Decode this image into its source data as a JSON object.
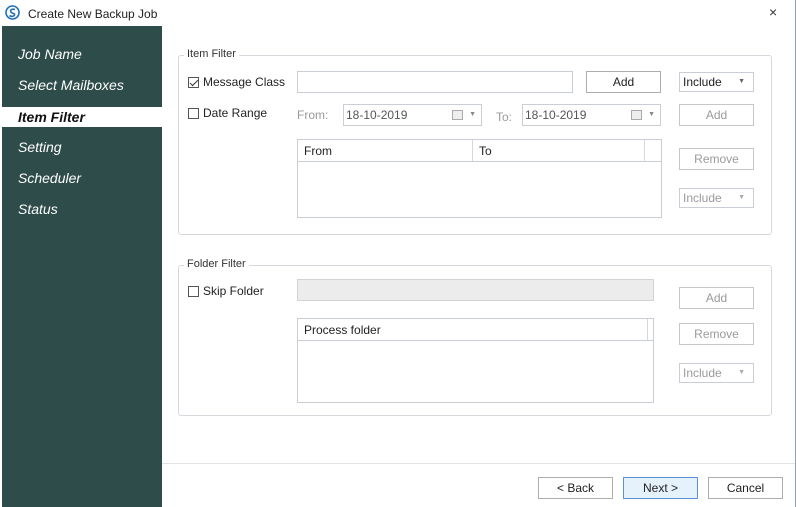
{
  "window": {
    "title": "Create New Backup Job",
    "close_glyph": "×"
  },
  "sidebar": {
    "items": [
      {
        "label": "Job Name"
      },
      {
        "label": "Select Mailboxes"
      },
      {
        "label": "Item Filter"
      },
      {
        "label": "Setting"
      },
      {
        "label": "Scheduler"
      },
      {
        "label": "Status"
      }
    ],
    "active_index": 2
  },
  "item_filter": {
    "title": "Item Filter",
    "message_class_label": "Message Class",
    "message_class_checked": true,
    "message_class_value": "",
    "add_label": "Add",
    "include_select": "Include",
    "date_range_label": "Date Range",
    "date_range_checked": false,
    "from_label": "From:",
    "from_date": "18-10-2019",
    "to_label": "To:",
    "to_date": "18-10-2019",
    "add_date_label": "Add",
    "list_columns": [
      "From",
      "To"
    ],
    "remove_label": "Remove",
    "include_select_2": "Include"
  },
  "folder_filter": {
    "title": "Folder Filter",
    "skip_folder_label": "Skip Folder",
    "skip_folder_checked": false,
    "add_label": "Add",
    "list_column": "Process folder",
    "remove_label": "Remove",
    "include_select": "Include"
  },
  "footer": {
    "back_label": "< Back",
    "next_label": "Next >",
    "cancel_label": "Cancel"
  },
  "colors": {
    "sidebar_bg": "#2e4d4a",
    "accent": "#5b8fd6"
  }
}
